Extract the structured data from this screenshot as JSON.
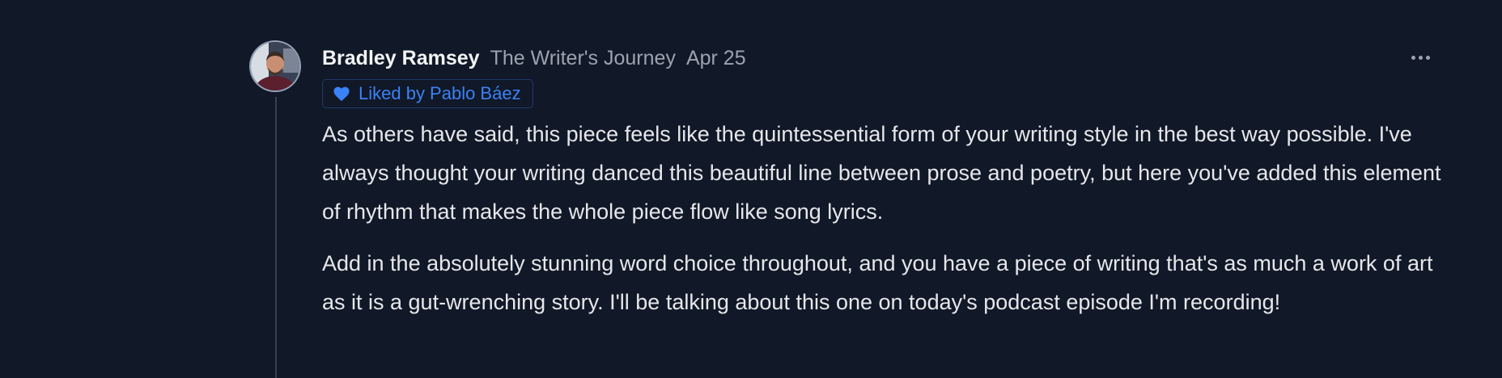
{
  "comment": {
    "author": "Bradley Ramsey",
    "publication": "The Writer's Journey",
    "date": "Apr 25",
    "liked_by": "Liked by Pablo Báez",
    "paragraphs": [
      "As others have said, this piece feels like the quintessential form of your writing style in the best way possible. I've always thought your writing danced this beautiful line between prose and poetry, but here you've added this element of rhythm that makes the whole piece flow like song lyrics.",
      "Add in the absolutely stunning word choice throughout, and you have a piece of writing that's as much a work of art as it is a gut-wrenching story. I'll be talking about this one on today's podcast episode I'm recording!"
    ]
  },
  "icons": {
    "more": "more-horizontal-icon",
    "heart": "heart-icon",
    "avatar": "user-avatar"
  },
  "colors": {
    "background": "#111827",
    "accent": "#3b82f6",
    "muted_text": "#9ca3af",
    "body_text": "#e5e7eb"
  }
}
